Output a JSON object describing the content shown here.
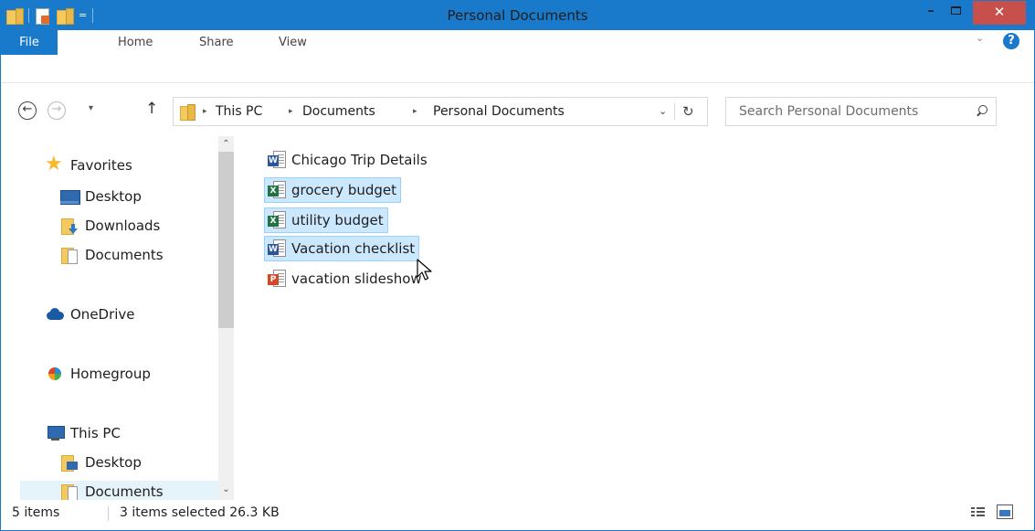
{
  "window": {
    "title": "Personal Documents",
    "qat_dropdown": "="
  },
  "ribbon": {
    "tabs": [
      "File",
      "Home",
      "Share",
      "View"
    ],
    "help": "?"
  },
  "nav": {
    "back": "←",
    "forward": "→",
    "up": "↑",
    "recent": "▾"
  },
  "address": {
    "crumbs": [
      "This PC",
      "Documents",
      "Personal Documents"
    ],
    "separator": "▸",
    "dropdown": "⌄",
    "refresh": "↻"
  },
  "search": {
    "placeholder": "Search Personal Documents"
  },
  "navpane": {
    "items": [
      {
        "label": "Favorites",
        "icon": "star-icon"
      },
      {
        "label": "Desktop",
        "icon": "desktop-icon"
      },
      {
        "label": "Downloads",
        "icon": "downloads-folder-icon"
      },
      {
        "label": "Documents",
        "icon": "documents-folder-icon"
      },
      {
        "label": "OneDrive",
        "icon": "onedrive-icon"
      },
      {
        "label": "Homegroup",
        "icon": "homegroup-icon"
      },
      {
        "label": "This PC",
        "icon": "computer-icon"
      },
      {
        "label": "Desktop",
        "icon": "desktop-folder-icon"
      },
      {
        "label": "Documents",
        "icon": "documents-folder-icon"
      }
    ],
    "scroll_up": "⌃",
    "scroll_down": "⌄"
  },
  "files": [
    {
      "name": "Chicago Trip Details",
      "type": "word",
      "selected": false
    },
    {
      "name": "grocery budget",
      "type": "excel",
      "selected": true
    },
    {
      "name": "utility budget",
      "type": "excel",
      "selected": true
    },
    {
      "name": "Vacation checklist",
      "type": "word",
      "selected": true
    },
    {
      "name": "vacation slideshow",
      "type": "powerpoint",
      "selected": false
    }
  ],
  "status": {
    "item_count": "5 items",
    "selection": "3 items selected  26.3 KB"
  },
  "colors": {
    "accent": "#1979ca",
    "close": "#c7504c",
    "selection": "#cce8ff",
    "selection_border": "#99d1ff"
  }
}
